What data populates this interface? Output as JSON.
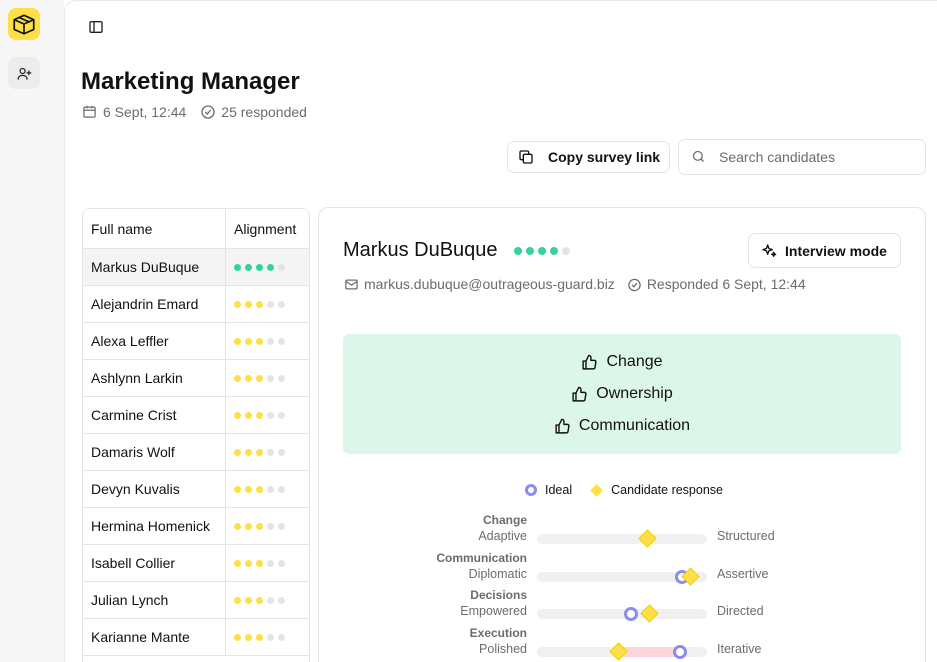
{
  "app": {
    "logo_icon": "box-icon",
    "rail_items": [
      {
        "icon": "user-plus-icon"
      }
    ]
  },
  "header": {
    "sidebar_toggle_icon": "sidebar-toggle-icon",
    "title": "Marketing Manager",
    "date": "6 Sept, 12:44",
    "responded": "25 responded"
  },
  "toolbar": {
    "copy_label": "Copy survey link",
    "search_placeholder": "Search candidates"
  },
  "table": {
    "col_name": "Full name",
    "col_alignment": "Alignment",
    "rows": [
      {
        "name": "Markus DuBuque",
        "score": 4,
        "color": "#34d399",
        "selected": true
      },
      {
        "name": "Alejandrin Emard",
        "score": 3,
        "color": "#fde047",
        "selected": false
      },
      {
        "name": "Alexa Leffler",
        "score": 3,
        "color": "#fde047",
        "selected": false
      },
      {
        "name": "Ashlynn Larkin",
        "score": 3,
        "color": "#fde047",
        "selected": false
      },
      {
        "name": "Carmine Crist",
        "score": 3,
        "color": "#fde047",
        "selected": false
      },
      {
        "name": "Damaris Wolf",
        "score": 3,
        "color": "#fde047",
        "selected": false
      },
      {
        "name": "Devyn Kuvalis",
        "score": 3,
        "color": "#fde047",
        "selected": false
      },
      {
        "name": "Hermina Homenick",
        "score": 3,
        "color": "#fde047",
        "selected": false
      },
      {
        "name": "Isabell Collier",
        "score": 3,
        "color": "#fde047",
        "selected": false
      },
      {
        "name": "Julian Lynch",
        "score": 3,
        "color": "#fde047",
        "selected": false
      },
      {
        "name": "Karianne Mante",
        "score": 3,
        "color": "#fde047",
        "selected": false
      }
    ]
  },
  "candidate": {
    "name": "Markus DuBuque",
    "score": 4,
    "score_color": "#34d399",
    "interview_label": "Interview mode",
    "email": "markus.dubuque@outrageous-guard.biz",
    "responded": "Responded 6 Sept, 12:44",
    "strengths": [
      "Change",
      "Ownership",
      "Communication"
    ],
    "legend": {
      "ideal": "Ideal",
      "candidate": "Candidate response"
    },
    "scales": [
      {
        "category": "Change",
        "low": "Adaptive",
        "high": "Structured",
        "ideal": null,
        "candidate": 0.65
      },
      {
        "category": "Communication",
        "low": "Diplomatic",
        "high": "Assertive",
        "ideal": 0.85,
        "candidate": 0.9
      },
      {
        "category": "Decisions",
        "low": "Empowered",
        "high": "Directed",
        "ideal": 0.55,
        "candidate": 0.66
      },
      {
        "category": "Execution",
        "low": "Polished",
        "high": "Iterative",
        "ideal": 0.84,
        "candidate": 0.48
      }
    ]
  },
  "colors": {
    "accent_yellow": "#fde047",
    "good_green": "#34d399",
    "ideal_purple": "#8b8cf0",
    "strength_bg": "#ddf6ea"
  }
}
